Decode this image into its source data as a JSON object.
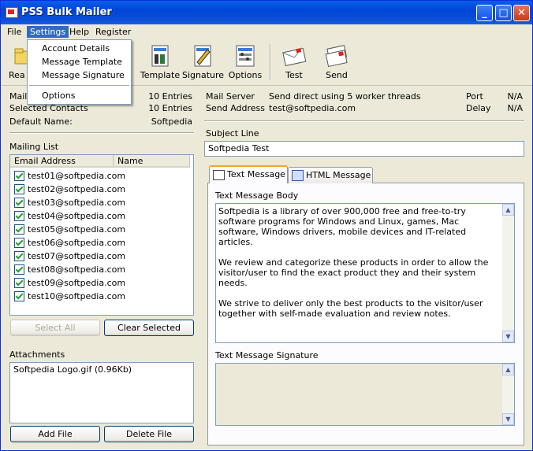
{
  "window": {
    "title": "PSS Bulk Mailer"
  },
  "menubar": {
    "file": "File",
    "settings": "Settings",
    "help": "Help",
    "register": "Register"
  },
  "settings_menu": {
    "items": [
      "Account Details",
      "Message Template",
      "Message Signature",
      "Options"
    ]
  },
  "toolbar": {
    "read_partial": "Rea",
    "template": "Template",
    "signature": "Signature",
    "options": "Options",
    "test": "Test",
    "send": "Send"
  },
  "info": {
    "mail_partial": "Mail",
    "mail_value": "10 Entries",
    "selected_label": "Selected Contacts",
    "selected_value": "10 Entries",
    "default_label": "Default Name:",
    "default_value": "Softpedia",
    "server_label": "Mail Server",
    "server_value": "Send direct using 5 worker threads",
    "send_addr_label": "Send Address",
    "send_addr_value": "test@softpedia.com",
    "port_label": "Port",
    "port_value": "N/A",
    "delay_label": "Delay",
    "delay_value": "N/A"
  },
  "mailing_list": {
    "label": "Mailing List",
    "col_email": "Email Address",
    "col_name": "Name",
    "rows": [
      "test01@softpedia.com",
      "test02@softpedia.com",
      "test03@softpedia.com",
      "test04@softpedia.com",
      "test05@softpedia.com",
      "test06@softpedia.com",
      "test07@softpedia.com",
      "test08@softpedia.com",
      "test09@softpedia.com",
      "test10@softpedia.com"
    ],
    "select_all": "Select All",
    "clear_selected": "Clear Selected"
  },
  "attachments": {
    "label": "Attachments",
    "items": [
      "Softpedia Logo.gif (0.96Kb)"
    ],
    "add_file": "Add File",
    "delete_file": "Delete File"
  },
  "subject": {
    "label": "Subject Line",
    "value": "Softpedia Test"
  },
  "tabs": {
    "text": "Text Message",
    "html": "HTML Message"
  },
  "message": {
    "body_label": "Text Message Body",
    "paragraphs": [
      "Softpedia is a library of over 900,000 free and free-to-try software programs for Windows and Linux, games, Mac software, Windows drivers, mobile devices and IT-related articles.",
      "We review and categorize these products in order to allow the visitor/user to find the exact product they and their system needs.",
      "We strive to deliver only the best products to the visitor/user together with self-made evaluation and review notes."
    ],
    "signature_label": "Text Message Signature"
  },
  "colors": {
    "accent": "#316ac5",
    "titlebar": "#0046d8",
    "face": "#ece9d8"
  }
}
